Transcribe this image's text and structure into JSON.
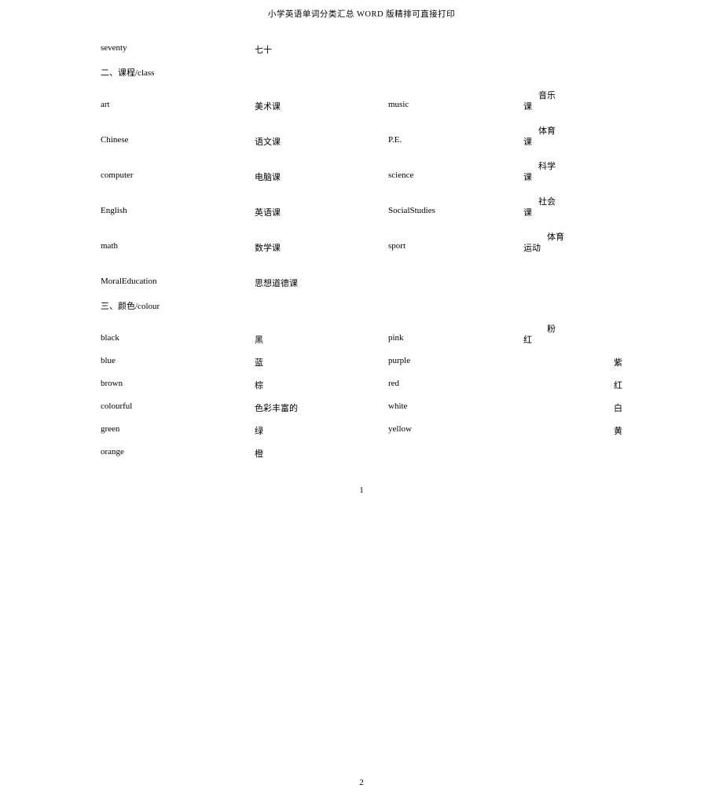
{
  "page_header": "小学英语单词分类汇总 WORD 版精排可直接打印",
  "first_row": {
    "en": "seventy",
    "cn": "七十"
  },
  "section2_heading": "二、课程/class",
  "section2_rows": [
    {
      "en_l": "art",
      "cn_l": "美术课",
      "en_r": "music",
      "cnr_a": "课",
      "cnr_b": "音乐"
    },
    {
      "en_l": "Chinese",
      "cn_l": "语文课",
      "en_r": "P.E.",
      "cnr_a": "课",
      "cnr_b": "体育"
    },
    {
      "en_l": "computer",
      "cn_l": "电脑课",
      "en_r": "science",
      "cnr_a": "课",
      "cnr_b": "科学"
    },
    {
      "en_l": "English",
      "cn_l": "英语课",
      "en_r": "SocialStudies",
      "cnr_a": "课",
      "cnr_b": "社会"
    },
    {
      "en_l": "math",
      "cn_l": "数学课",
      "en_r": "sport",
      "cnr_a": "运动",
      "cnr_b": "体育"
    },
    {
      "en_l": "MoralEducation",
      "cn_l": "思想道德课",
      "en_r": "",
      "cnr_a": "",
      "cnr_b": ""
    }
  ],
  "section3_heading": "三、颜色/colour",
  "section3_rows": [
    {
      "en_l": "black",
      "cn_l": "黑",
      "en_r": "pink",
      "cnr_a": "红",
      "cnr_b": "粉"
    },
    {
      "en_l": "blue",
      "cn_l": "蓝",
      "en_r": "purple",
      "cnr_a": "",
      "cnr_b": "紫"
    },
    {
      "en_l": "brown",
      "cn_l": "棕",
      "en_r": "red",
      "cnr_a": "",
      "cnr_b": "红"
    },
    {
      "en_l": "colourful",
      "cn_l": "色彩丰富的",
      "en_r": "white",
      "cnr_a": "",
      "cnr_b": "白"
    },
    {
      "en_l": "green",
      "cn_l": "绿",
      "en_r": "yellow",
      "cnr_a": "",
      "cnr_b": "黄"
    },
    {
      "en_l": "orange",
      "cn_l": "橙",
      "en_r": "",
      "cnr_a": "",
      "cnr_b": ""
    }
  ],
  "pagenum1": "1",
  "pagenum2": "2"
}
